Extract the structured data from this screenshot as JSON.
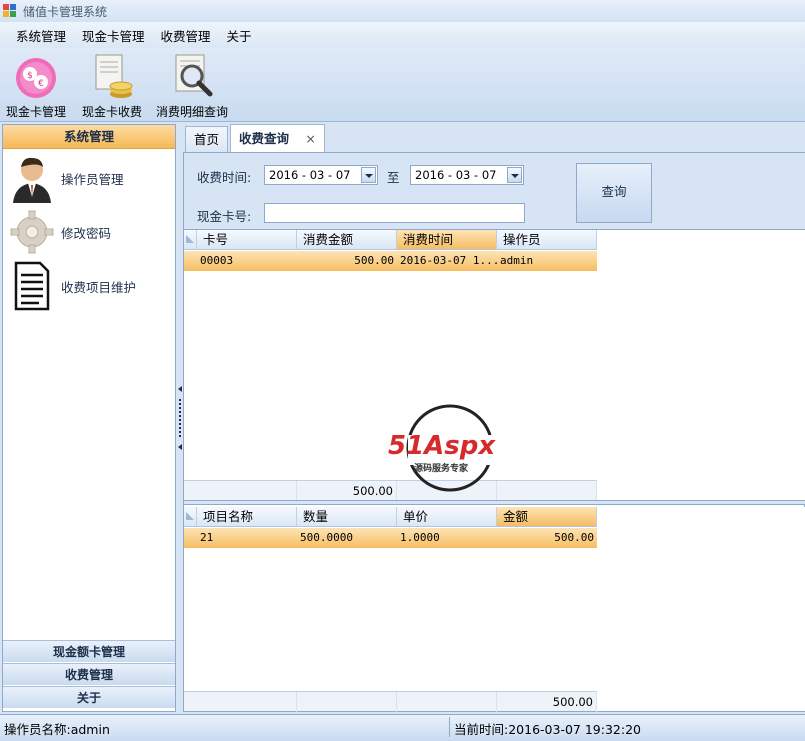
{
  "window": {
    "title": "储值卡管理系统"
  },
  "menu": [
    "系统管理",
    "现金卡管理",
    "收费管理",
    "关于"
  ],
  "toolbar": [
    {
      "label": "现金卡管理",
      "icon": "money-card-icon"
    },
    {
      "label": "现金卡收费",
      "icon": "coins-document-icon"
    },
    {
      "label": "消费明细查询",
      "icon": "magnifier-icon"
    }
  ],
  "sidebar": {
    "header": "系统管理",
    "items": [
      {
        "label": "操作员管理",
        "icon": "operator-avatar-icon"
      },
      {
        "label": "修改密码",
        "icon": "gear-icon"
      },
      {
        "label": "收费项目维护",
        "icon": "document-icon"
      }
    ],
    "bottom": [
      "现金额卡管理",
      "收费管理",
      "关于"
    ]
  },
  "tabs": {
    "home": "首页",
    "query": "收费查询",
    "close": "×"
  },
  "query": {
    "time_label": "收费时间:",
    "to_label": "至",
    "date_from": "2016 - 03 - 07",
    "date_to": "2016 - 03 - 07",
    "card_label": "现金卡号:",
    "card_value": "",
    "button": "查询"
  },
  "grid1": {
    "columns": [
      "卡号",
      "消费金额",
      "消费时间",
      "操作员"
    ],
    "rows": [
      [
        "00003",
        "500.00",
        "2016-03-07 1...",
        "admin"
      ]
    ],
    "footer_total": "500.00"
  },
  "grid2": {
    "columns": [
      "项目名称",
      "数量",
      "单价",
      "金额"
    ],
    "rows": [
      [
        "21",
        "500.0000",
        "1.0000",
        "500.00"
      ]
    ],
    "footer_total": "500.00"
  },
  "watermark": {
    "brand": "51Aspx",
    "tagline": "源码服务专家"
  },
  "status": {
    "operator": "操作员名称:admin",
    "time": "当前时间:2016-03-07 19:32:20"
  },
  "colors": {
    "accent": "#f6b955",
    "panel": "#d6e4f3",
    "border": "#8ea9cc"
  }
}
